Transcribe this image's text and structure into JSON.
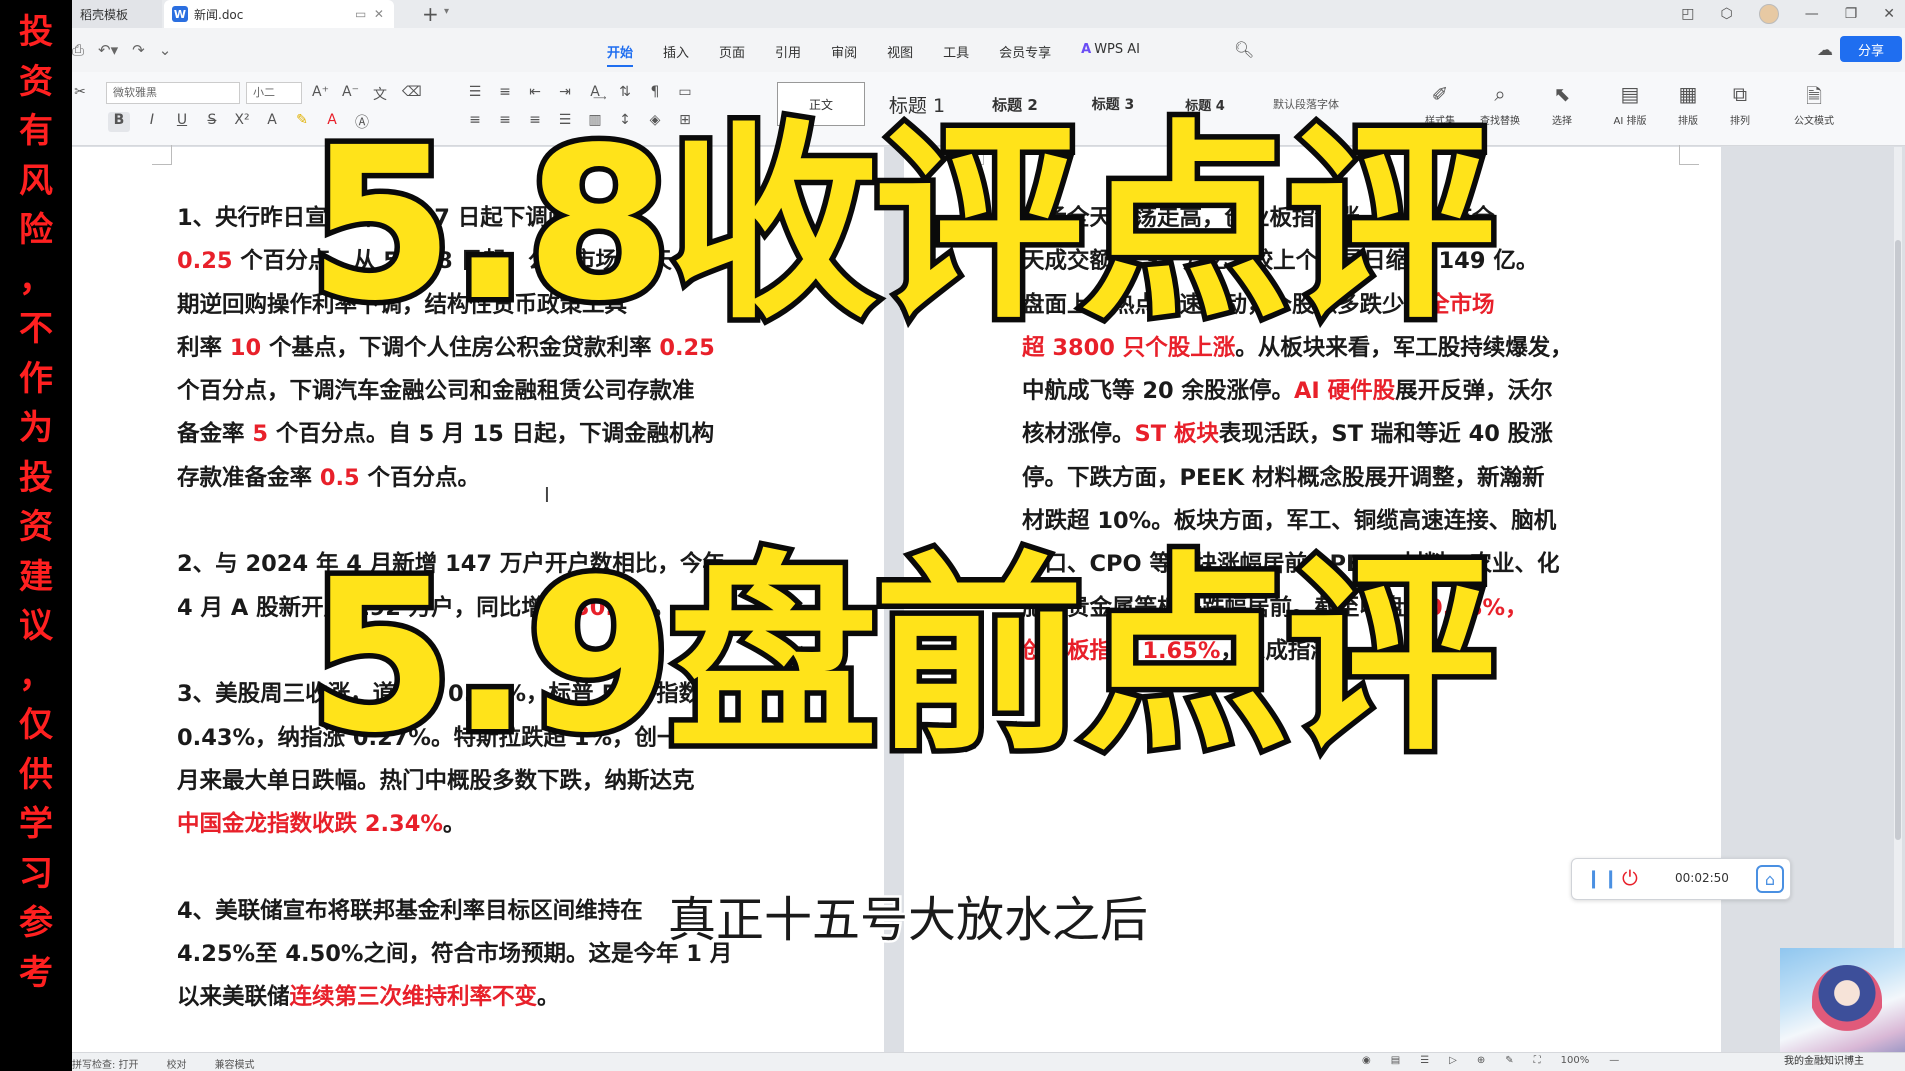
{
  "disclaimer": "投资有风险，不作为投资建议，仅供学习参考",
  "tabs": {
    "template": "稻壳模板",
    "document": "新闻.doc",
    "doc_icon": "W",
    "new_tab": "+"
  },
  "menu": {
    "items": [
      "开始",
      "插入",
      "页面",
      "引用",
      "审阅",
      "视图",
      "工具",
      "会员专享"
    ],
    "wps_ai": "WPS AI",
    "share": "分享"
  },
  "toolbar": {
    "font_name": "微软雅黑",
    "font_size": "小二",
    "bold": "B",
    "italic": "I",
    "underline": "U",
    "styles": [
      "正文",
      "标题 1",
      "标题 2",
      "标题 3",
      "标题 4",
      "默认段落字体"
    ],
    "tools": [
      "样式集",
      "查找替换",
      "选择",
      "AI 排版",
      "排版",
      "排列",
      "公文模式"
    ]
  },
  "left_column": [
    [
      {
        "t": "1、央行昨日宣布自 5 月 7 日起下调政策利率"
      }
    ],
    [
      {
        "t": "0.25",
        "r": true
      },
      {
        "t": " 个百分点。从 5 月 8 日起，公开市场 7 天"
      }
    ],
    [
      {
        "t": "期逆回购操作利率下调，结构性货币政策工具"
      }
    ],
    [
      {
        "t": "利率 "
      },
      {
        "t": "10",
        "r": true
      },
      {
        "t": " 个基点，下调个人住房公积金贷款利率 "
      },
      {
        "t": "0.25",
        "r": true
      }
    ],
    [
      {
        "t": "个百分点，下调汽车金融公司和金融租赁公司存款准"
      }
    ],
    [
      {
        "t": "备金率 "
      },
      {
        "t": "5",
        "r": true
      },
      {
        "t": " 个百分点。自 5 月 15 日起，下调金融机构"
      }
    ],
    [
      {
        "t": "存款准备金率 "
      },
      {
        "t": "0.5",
        "r": true
      },
      {
        "t": " 个百分点。"
      }
    ],
    [],
    [
      {
        "t": "2、与 2024 年 4 月新增 147 万户开户数相比，今年"
      }
    ],
    [
      {
        "t": "4 月 A 股新开户 192 万户，同比增长 "
      },
      {
        "t": "30.6%",
        "r": true
      },
      {
        "t": "。"
      }
    ],
    [],
    [
      {
        "t": "3、美股周三收涨，道指涨 0.70%，标普 500 指数涨"
      }
    ],
    [
      {
        "t": "0.43%，纳指涨 0.27%。特斯拉跌超 1%，创一个"
      }
    ],
    [
      {
        "t": "月来最大单日跌幅。热门中概股多数下跌，纳斯达克"
      }
    ],
    [
      {
        "t": "中国金龙指数收跌 2.34%",
        "r": true
      },
      {
        "t": "。"
      }
    ],
    [],
    [
      {
        "t": "4、美联储宣布将联邦基金利率目标区间维持在"
      }
    ],
    [
      {
        "t": "4.25%至 4.50%之间，符合市场预期。这是今年 1 月"
      }
    ],
    [
      {
        "t": "以来美联储"
      },
      {
        "t": "连续第三次维持利率不变",
        "r": true
      },
      {
        "t": "。"
      }
    ]
  ],
  "right_column": [
    [
      {
        "t": "市场全天震荡走高，创业板指领涨。沪深两市全"
      }
    ],
    [
      {
        "t": "天成交额 1.31 万亿，较上个交易日缩量 149 亿。"
      }
    ],
    [
      {
        "t": "盘面上，热点快速轮动，个股涨多跌少，"
      },
      {
        "t": "全市场",
        "r": true
      }
    ],
    [
      {
        "t": "超 3800 只个股上涨",
        "r": true
      },
      {
        "t": "。从板块来看，军工股持续爆发，"
      }
    ],
    [
      {
        "t": "中航成飞等 20 余股涨停。"
      },
      {
        "t": "AI 硬件股",
        "r": true
      },
      {
        "t": "展开反弹，沃尔"
      }
    ],
    [
      {
        "t": "核材涨停。"
      },
      {
        "t": "ST 板块",
        "r": true
      },
      {
        "t": "表现活跃，ST 瑞和等近 40 股涨"
      }
    ],
    [
      {
        "t": "停。下跌方面，PEEK 材料概念股展开调整，新瀚新"
      }
    ],
    [
      {
        "t": "材跌超 10%。板块方面，军工、铜缆高速连接、脑机"
      }
    ],
    [
      {
        "t": "接口、CPO 等板块涨幅居前，PEEK 材料、农业、化"
      }
    ],
    [
      {
        "t": "肥、贵金属等板块跌幅居前。截至收盘，"
      },
      {
        "t": "0.28%，",
        "r": true
      }
    ],
    [
      {
        "t": "创业板指涨 1.65%",
        "r": true
      },
      {
        "t": "，深成指涨"
      }
    ]
  ],
  "overlay": {
    "title_1": "5.8收评点评",
    "title_2": "5.9盘前点评",
    "subtitle": "真正十五号大放水之后"
  },
  "recorder": {
    "time": "00:02:50"
  },
  "status_bar": {
    "spellcheck": "拼写检查: 打开",
    "proof": "校对",
    "compat": "兼容模式",
    "zoom": "100%"
  },
  "anime_caption": "我的金融知识博主"
}
